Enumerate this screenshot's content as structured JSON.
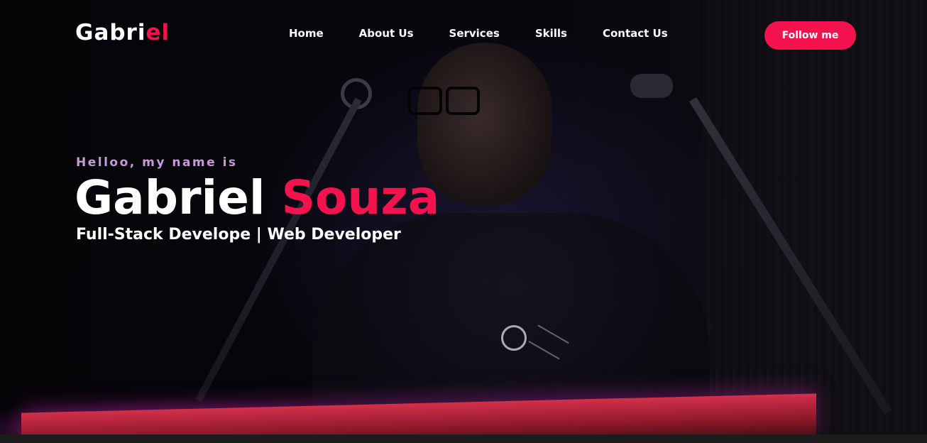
{
  "brand": {
    "name_main": "Gabri",
    "name_accent": "el"
  },
  "nav": {
    "items": [
      {
        "label": "Home"
      },
      {
        "label": "About Us"
      },
      {
        "label": "Services"
      },
      {
        "label": "Skills"
      },
      {
        "label": "Contact Us"
      }
    ],
    "cta_label": "Follow me"
  },
  "hero": {
    "greeting": "Helloo, my name is",
    "first_name": "Gabriel",
    "last_name": "Souza",
    "role": "Full-Stack Develope | Web Developer"
  },
  "colors": {
    "accent": "#f5134f",
    "greeting": "#c79ad8",
    "text": "#ffffff",
    "background": "#050508"
  }
}
